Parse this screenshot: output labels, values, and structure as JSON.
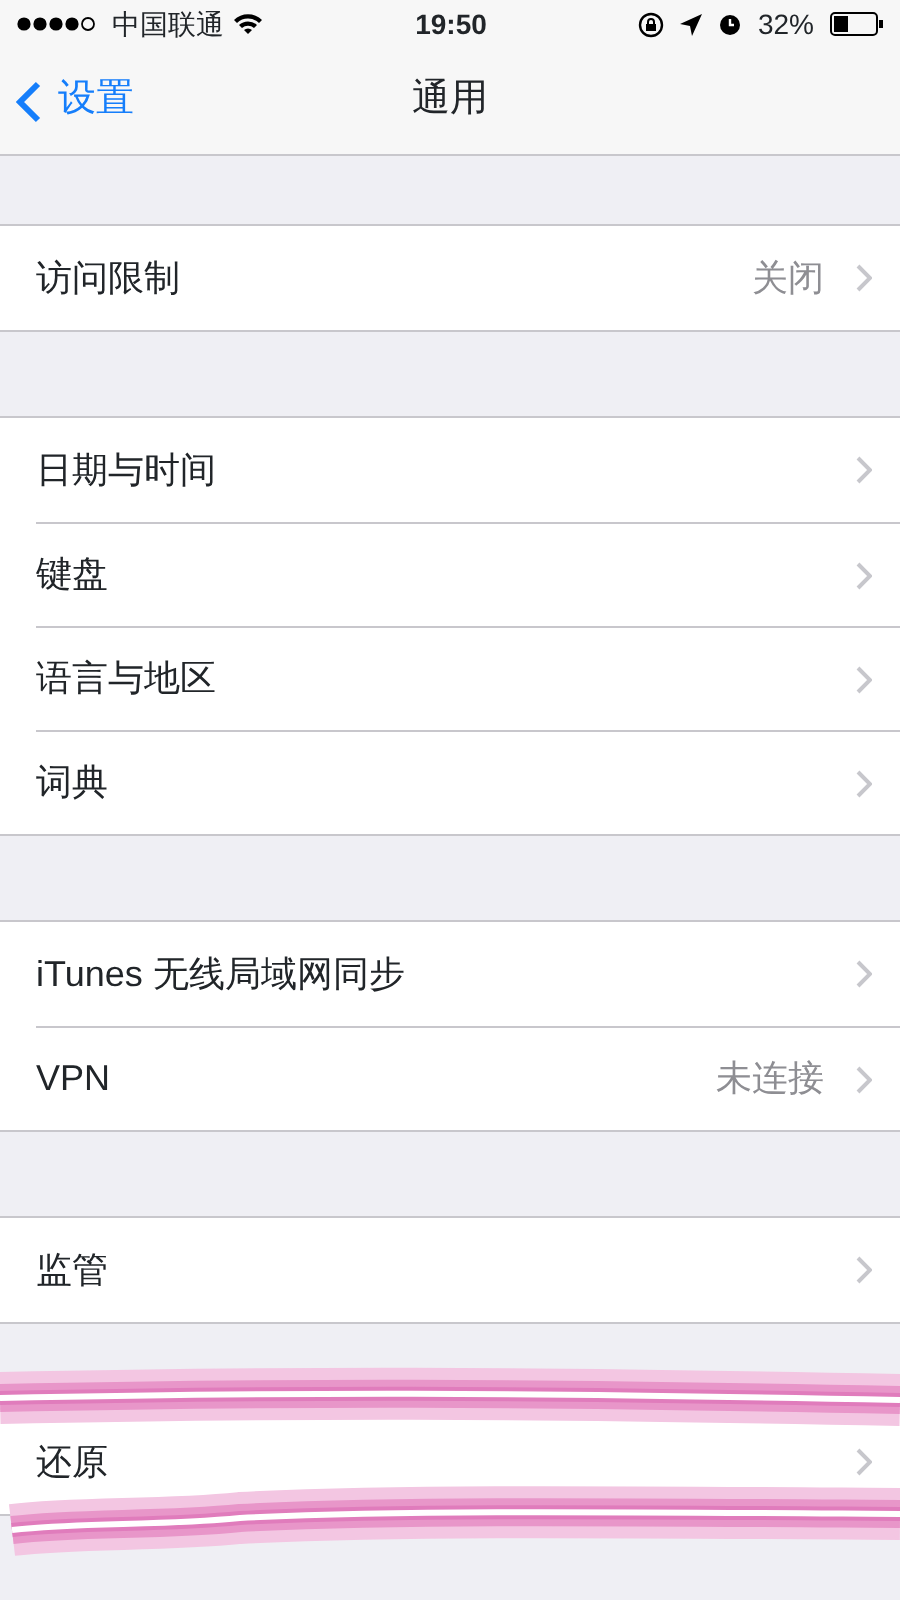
{
  "status_bar": {
    "carrier": "中国联通",
    "time": "19:50",
    "battery": "32%"
  },
  "nav": {
    "back": "设置",
    "title": "通用"
  },
  "groups": [
    {
      "rows": [
        {
          "label": "访问限制",
          "value": "关闭",
          "highlighted": false
        }
      ]
    },
    {
      "rows": [
        {
          "label": "日期与时间",
          "highlighted": false
        },
        {
          "label": "键盘",
          "highlighted": false
        },
        {
          "label": "语言与地区",
          "highlighted": false
        },
        {
          "label": "词典",
          "highlighted": false
        }
      ]
    },
    {
      "rows": [
        {
          "label": "iTunes 无线局域网同步",
          "highlighted": false
        },
        {
          "label": "VPN",
          "value": "未连接",
          "highlighted": false
        }
      ]
    },
    {
      "rows": [
        {
          "label": "监管",
          "highlighted": false
        }
      ]
    },
    {
      "rows": [
        {
          "label": "还原",
          "highlighted": true
        }
      ]
    }
  ]
}
